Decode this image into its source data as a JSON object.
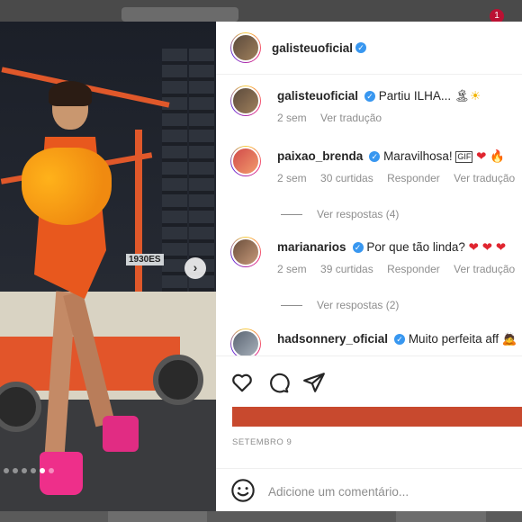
{
  "backdrop": {
    "badge_count": "1"
  },
  "post": {
    "author": "galisteuoficial",
    "date": "SETEMBRO 9",
    "carousel": {
      "total": 6,
      "active": 5
    }
  },
  "caption": {
    "username": "galisteuoficial",
    "text": "Partiu ILHA...",
    "time": "2 sem",
    "translate": "Ver tradução"
  },
  "comments": [
    {
      "username": "paixao_brenda",
      "text": "Maravilhosa!",
      "time": "2 sem",
      "likes": "30 curtidas",
      "reply": "Responder",
      "translate": "Ver tradução",
      "replies": "Ver respostas (4)"
    },
    {
      "username": "marianarios",
      "text": "Por que tão linda?",
      "time": "2 sem",
      "likes": "39 curtidas",
      "reply": "Responder",
      "translate": "Ver tradução",
      "replies": "Ver respostas (2)"
    },
    {
      "username": "hadsonnery_oficial",
      "text": "Muito perfeita aff"
    }
  ],
  "photo": {
    "sign_text": "1930ES"
  },
  "input": {
    "placeholder": "Adicione um comentário..."
  },
  "icons": {
    "next": "chevron-right-icon",
    "like": "heart-icon",
    "comment": "comment-icon",
    "share": "send-icon",
    "emoji": "smile-icon",
    "verified": "verified-badge-icon"
  },
  "colors": {
    "verified": "#3897f0",
    "promo_bar": "#c8492e",
    "text": "#262626",
    "muted": "#8e8e8e"
  }
}
